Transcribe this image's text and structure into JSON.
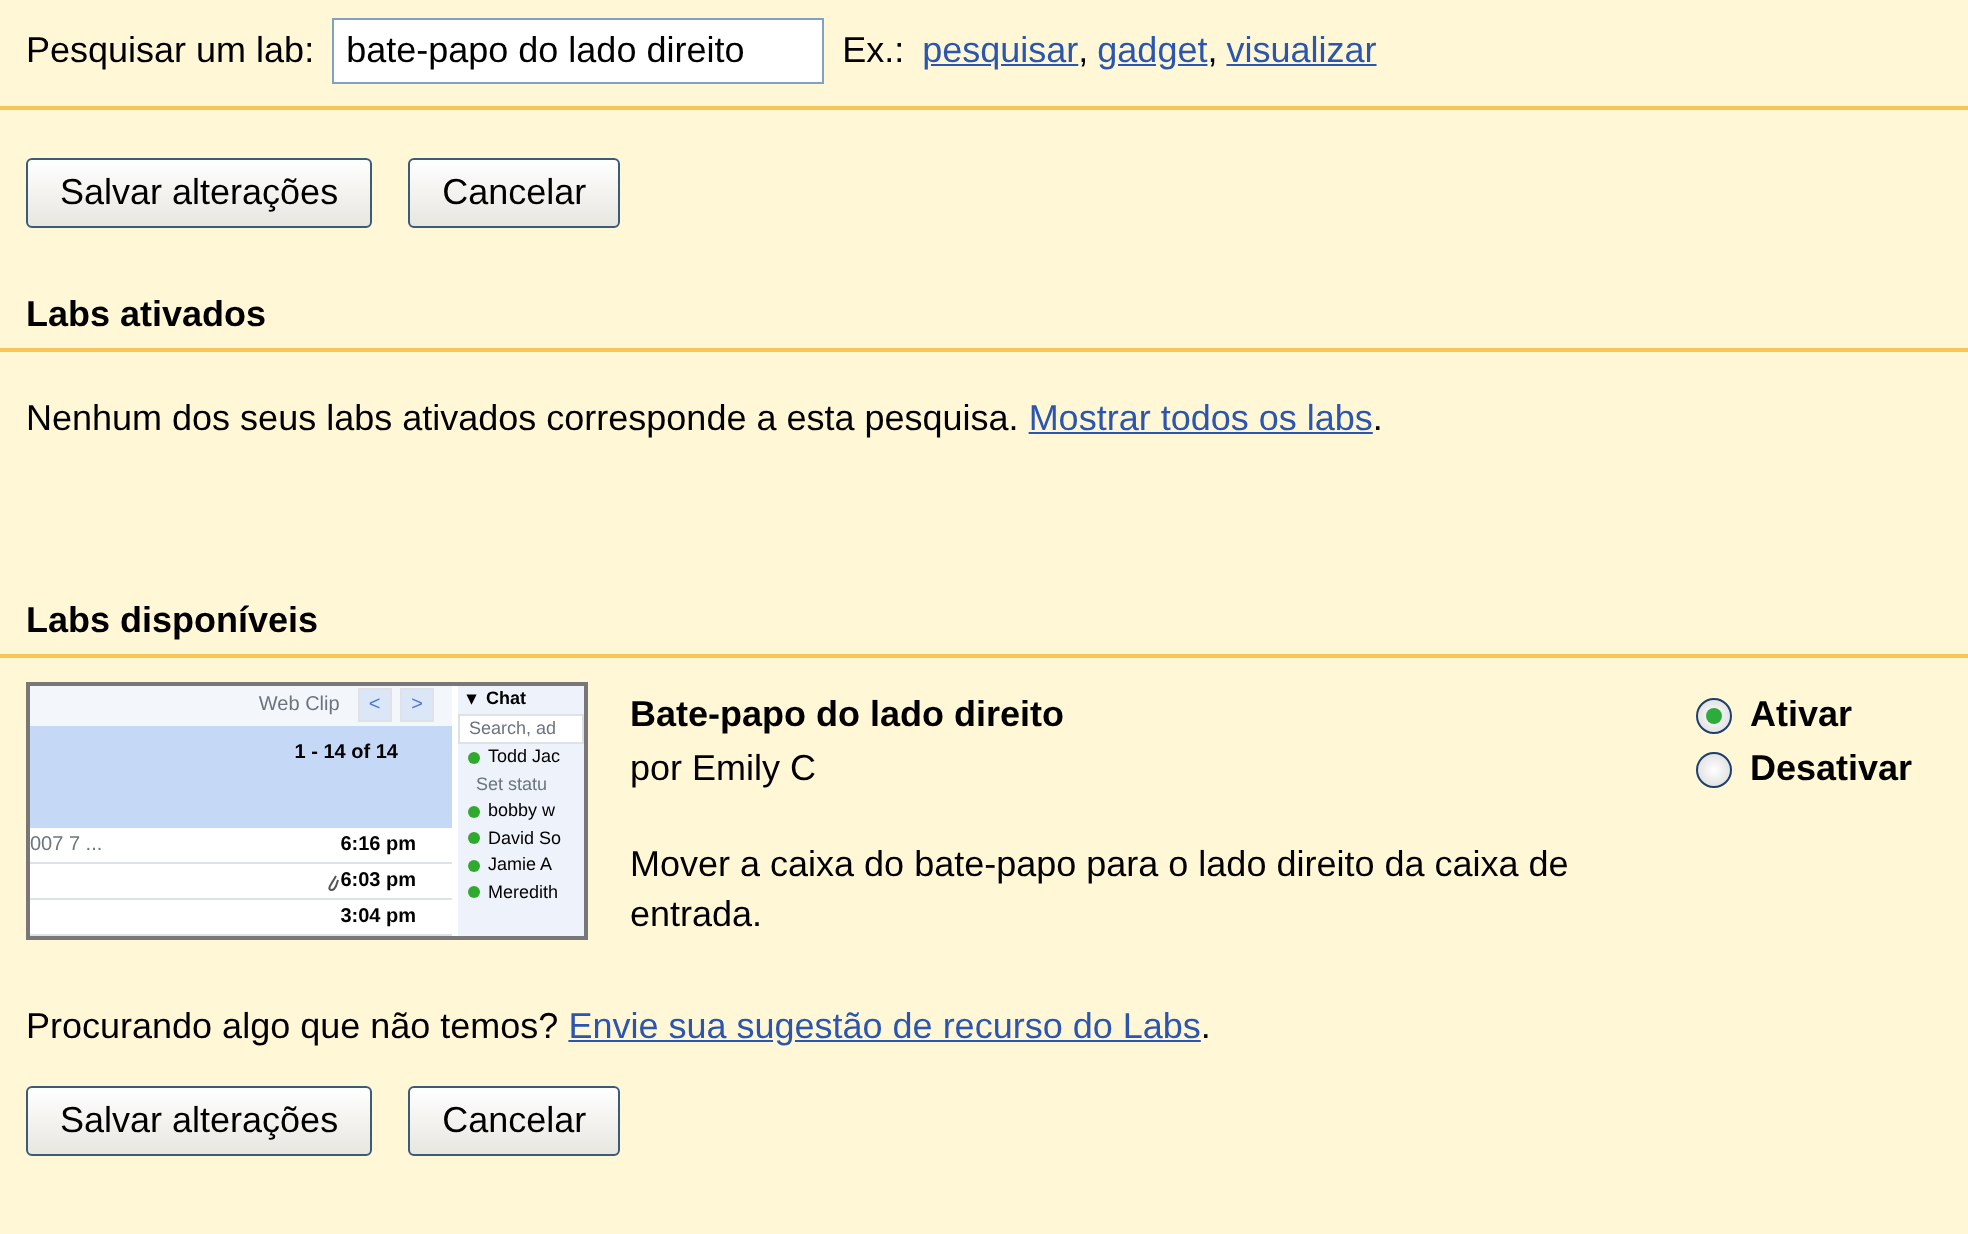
{
  "search": {
    "label": "Pesquisar um lab:",
    "value": "bate-papo do lado direito",
    "examples_label": "Ex.:",
    "examples": [
      "pesquisar",
      "gadget",
      "visualizar"
    ],
    "separator": ","
  },
  "top_buttons": [
    "Salvar alterações",
    "Cancelar"
  ],
  "enabled_section": {
    "title": "Labs ativados",
    "message": "Nenhum dos seus labs ativados corresponde a esta pesquisa.",
    "link": "Mostrar todos os labs",
    "end": "."
  },
  "available_section": {
    "title": "Labs disponíveis",
    "labs": [
      {
        "name": "Bate-papo do lado direito",
        "author": "por Emily C",
        "description": "Mover a caixa do bate-papo para o lado direito da caixa de entrada.",
        "options": [
          {
            "label": "Ativar",
            "selected": true
          },
          {
            "label": "Desativar",
            "selected": false
          }
        ],
        "thumbnail": {
          "web_clip": "Web Clip",
          "prev": "<",
          "next": ">",
          "count": "1 - 14 of 14",
          "mail_rows": [
            {
              "subject": "007 7 ...",
              "time": "6:16 pm",
              "attachment": false
            },
            {
              "subject": "",
              "time": "6:03 pm",
              "attachment": true
            },
            {
              "subject": "",
              "time": "3:04 pm",
              "attachment": false
            }
          ],
          "chat_toggle": "▾",
          "chat_title": "Chat",
          "chat_search": "Search, ad",
          "contacts": [
            {
              "name": "Todd Jac",
              "status": "Set statu"
            },
            {
              "name": "bobby w"
            },
            {
              "name": "David So"
            },
            {
              "name": "Jamie A"
            },
            {
              "name": "Meredith"
            }
          ]
        }
      }
    ]
  },
  "suggestion": {
    "text": "Procurando algo que não temos?",
    "link": "Envie sua sugestão de recurso do Labs",
    "end": "."
  },
  "bottom_buttons": [
    "Salvar alterações",
    "Cancelar"
  ]
}
